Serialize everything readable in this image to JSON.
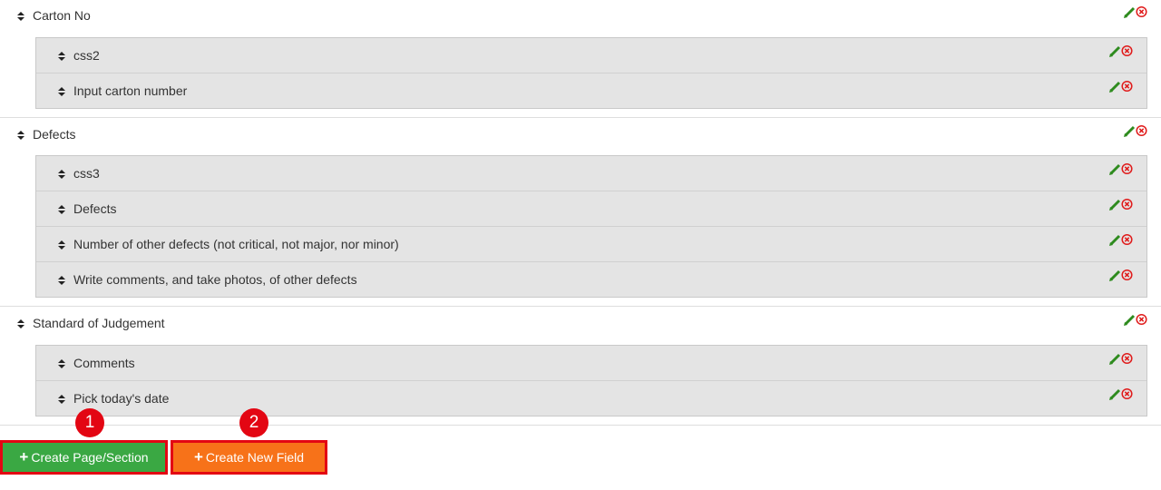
{
  "sections": [
    {
      "title": "Carton No",
      "fields": [
        "css2",
        "Input carton number"
      ]
    },
    {
      "title": "Defects",
      "fields": [
        "css3",
        "Defects",
        "Number of other defects (not critical, not major, nor minor)",
        "Write comments, and take photos, of other defects"
      ]
    },
    {
      "title": "Standard of Judgement",
      "fields": [
        "Comments",
        "Pick today's date"
      ]
    }
  ],
  "buttons": {
    "create_page": "Create Page/Section",
    "create_field": "Create New Field",
    "plus": "+"
  },
  "badges": [
    "1",
    "2"
  ],
  "colors": {
    "green_button": "#3aa843",
    "orange_button": "#f77219",
    "highlight_red": "#e30613",
    "edit_icon": "#2e8b1e",
    "delete_icon": "#e01b1b"
  }
}
